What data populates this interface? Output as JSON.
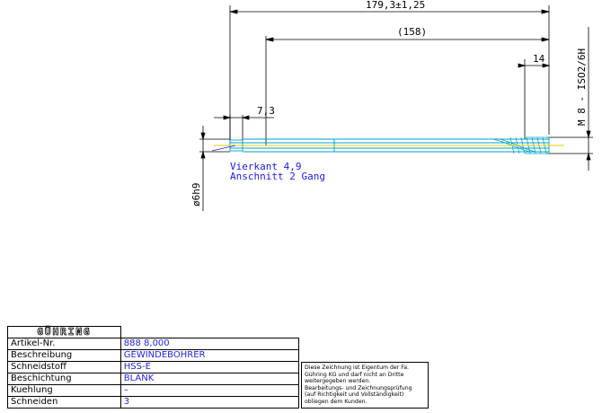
{
  "dimensions": {
    "overall_length": "179,3±1,25",
    "shank_length": "(158)",
    "square_length": "7,3",
    "thread_length": "14",
    "shank_diameter": "ø6h9",
    "thread_spec": "M 8 - ISO2/6H"
  },
  "annotations": {
    "square": "Vierkant 4,9",
    "chamfer": "Anschnitt 2 Gang"
  },
  "title_block": {
    "logo": "GÜHRING",
    "rows": [
      {
        "label": "Artikel-Nr.",
        "value": "888 8,000"
      },
      {
        "label": "Beschreibung",
        "value": "GEWINDEBOHRER"
      },
      {
        "label": "Schneidstoff",
        "value": "HSS-E"
      },
      {
        "label": "Beschichtung",
        "value": "BLANK"
      },
      {
        "label": "Kuehlung",
        "value": "–"
      },
      {
        "label": "Schneiden",
        "value": "3"
      }
    ]
  },
  "notice": {
    "lines": [
      "Diese Zeichnung ist Eigentum der Fa.",
      "Gühring KG und darf nicht an Dritte",
      "weitergegeben werden.",
      "Bearbeitungs- und Zeichnungsprüfung",
      "(auf Richtigkeit und Vollständigkeit)",
      "obliegen dem Kunden."
    ]
  },
  "colors": {
    "outline": "#00a0c8",
    "centerline": "#e6c800",
    "annotation": "#1a1ae6",
    "dimension": "#000000"
  }
}
